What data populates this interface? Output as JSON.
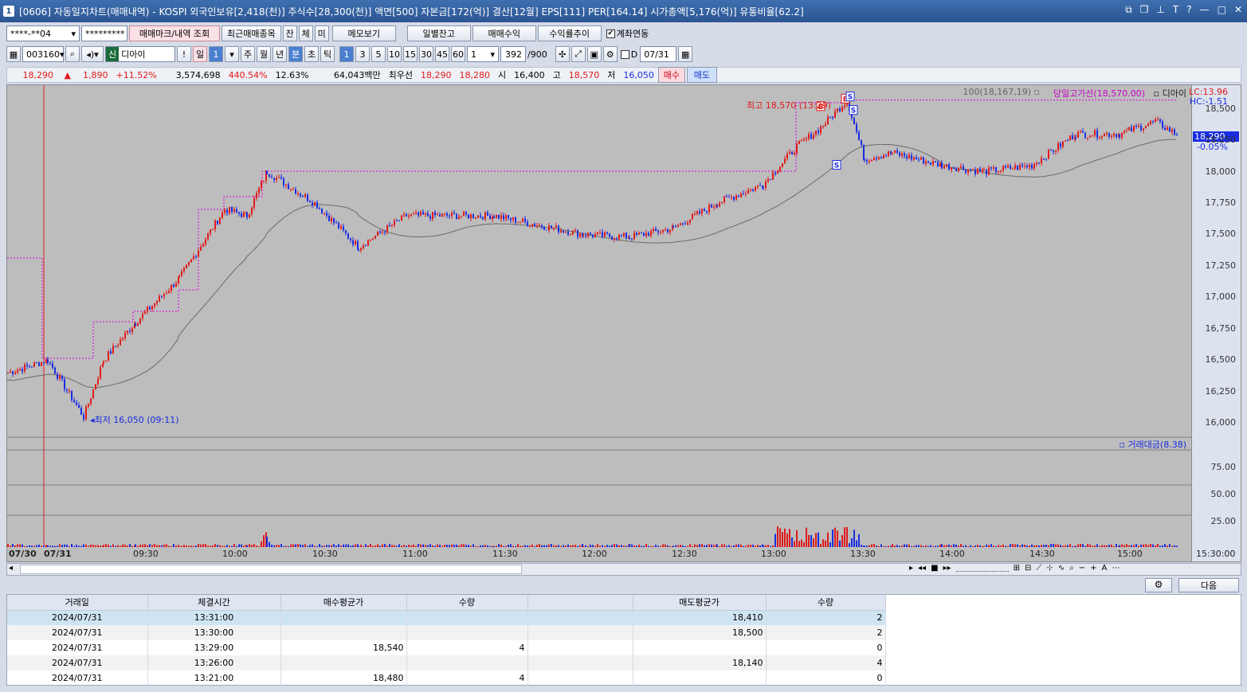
{
  "window": {
    "number": "1",
    "title": "[0606] 자동일지차트(매매내역) - KOSPI 외국인보유[2,418(천)] 주식수[28,300(천)] 액면[500] 자본금[172(억)] 결산[12월] EPS[111] PER[164.14] 시가총액[5,176(억)] 유통비율[62.2]"
  },
  "toolbar1": {
    "account": "****-**04",
    "password": "*********",
    "btn_mark": "매매마크/내역 조회",
    "btn_recent": "최근매매종목",
    "btn_jan": "잔",
    "btn_che": "체",
    "btn_mi": "미",
    "btn_memo": "메모보기",
    "btn_daily": "일별잔고",
    "btn_profit": "매매수익",
    "btn_return": "수익률추이",
    "chk_link": "계좌연동"
  },
  "toolbar2": {
    "code": "003160",
    "badge": "신",
    "name": "디아이",
    "day": "일",
    "day_n": "1",
    "week": "주",
    "month": "월",
    "year": "년",
    "minute": "분",
    "second": "초",
    "tick": "틱",
    "intervals": [
      "1",
      "3",
      "5",
      "10",
      "15",
      "30",
      "45",
      "60"
    ],
    "unit_val": "1",
    "count": "392",
    "count_max": "/900",
    "d_label": "D",
    "date": "07/31"
  },
  "infobar": {
    "price": "18,290",
    "arrow": "▲",
    "change": "1,890",
    "change_pct": "+11.52%",
    "volume": "3,574,698",
    "vol_ratio": "440.54%",
    "turnover": "12.63%",
    "amount": "64,043백만",
    "best_label": "최우선",
    "best_ask": "18,290",
    "best_bid": "18,280",
    "open_label": "시",
    "open": "16,400",
    "high_label": "고",
    "high": "18,570",
    "low_label": "저",
    "low": "16,050",
    "buy": "매수",
    "sell": "매도"
  },
  "chart": {
    "ma_label": "100(18,167,19)",
    "hl_label": "당일고가선(18,570.00)",
    "name_label": "디아이",
    "lc": "LC:13.96",
    "hc": "HC:-1.51",
    "cur_price": "18,290",
    "cur_pct": "-0.05%",
    "high_ann": "최고 18,570 (13:29)",
    "low_ann": "최저 16,050 (09:11)",
    "vol_label": "거래대금(8.38)",
    "price_ticks": [
      "18,500",
      "18,250",
      "18,000",
      "17,750",
      "17,500",
      "17,250",
      "17,000",
      "16,750",
      "16,500",
      "16,250",
      "16,000"
    ],
    "vol_ticks": [
      "75.00",
      "50.00",
      "25.00"
    ],
    "x_ticks": [
      "07/30",
      "07/31",
      "09:30",
      "10:00",
      "10:30",
      "11:00",
      "11:30",
      "12:00",
      "12:30",
      "13:00",
      "13:30",
      "14:00",
      "14:30",
      "15:00",
      "15:30:00"
    ],
    "markers": [
      "B",
      "B",
      "S",
      "S",
      "S"
    ]
  },
  "chart_data": {
    "type": "candlestick",
    "price_range": [
      15900,
      18650
    ],
    "ma_period": 100,
    "points": [
      {
        "t": "07/30",
        "c": 16400
      },
      {
        "t": "09:05",
        "c": 16500
      },
      {
        "t": "09:11",
        "c": 16050
      },
      {
        "t": "09:20",
        "c": 16500
      },
      {
        "t": "09:30",
        "c": 16800
      },
      {
        "t": "09:45",
        "c": 17150
      },
      {
        "t": "10:00",
        "c": 17700
      },
      {
        "t": "10:10",
        "c": 17650
      },
      {
        "t": "10:15",
        "c": 18000
      },
      {
        "t": "10:30",
        "c": 17750
      },
      {
        "t": "10:45",
        "c": 17400
      },
      {
        "t": "11:00",
        "c": 17650
      },
      {
        "t": "11:30",
        "c": 17650
      },
      {
        "t": "12:00",
        "c": 17500
      },
      {
        "t": "12:15",
        "c": 17480
      },
      {
        "t": "12:30",
        "c": 17550
      },
      {
        "t": "12:45",
        "c": 17750
      },
      {
        "t": "13:00",
        "c": 17900
      },
      {
        "t": "13:10",
        "c": 18200
      },
      {
        "t": "13:20",
        "c": 18350
      },
      {
        "t": "13:29",
        "c": 18570
      },
      {
        "t": "13:35",
        "c": 18100
      },
      {
        "t": "13:45",
        "c": 18150
      },
      {
        "t": "14:00",
        "c": 18050
      },
      {
        "t": "14:15",
        "c": 18000
      },
      {
        "t": "14:30",
        "c": 18050
      },
      {
        "t": "14:45",
        "c": 18300
      },
      {
        "t": "15:00",
        "c": 18300
      },
      {
        "t": "15:15",
        "c": 18400
      },
      {
        "t": "15:20",
        "c": 18290
      }
    ]
  },
  "table": {
    "headers": [
      "거래일",
      "체결시간",
      "매수평균가",
      "수량",
      "",
      "매도평균가",
      "수량"
    ],
    "rows": [
      [
        "2024/07/31",
        "13:31:00",
        "",
        "",
        "",
        "18,410",
        "2"
      ],
      [
        "2024/07/31",
        "13:30:00",
        "",
        "",
        "",
        "18,500",
        "2"
      ],
      [
        "2024/07/31",
        "13:29:00",
        "18,540",
        "4",
        "",
        "",
        "0"
      ],
      [
        "2024/07/31",
        "13:26:00",
        "",
        "",
        "",
        "18,140",
        "4"
      ],
      [
        "2024/07/31",
        "13:21:00",
        "18,480",
        "4",
        "",
        "",
        "0"
      ]
    ],
    "next_btn": "다음"
  }
}
